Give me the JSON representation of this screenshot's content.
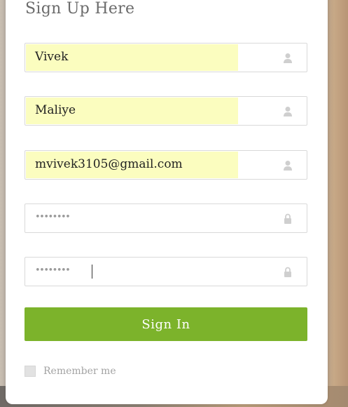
{
  "form": {
    "title": "Sign Up Here",
    "fields": {
      "first_name": {
        "value": "Vivek",
        "icon": "user-icon"
      },
      "last_name": {
        "value": "Maliye",
        "icon": "user-icon"
      },
      "email": {
        "value": "mvivek3105@gmail.com",
        "icon": "user-icon"
      },
      "password": {
        "value": "••••••••",
        "icon": "lock-icon"
      },
      "confirm_password": {
        "value": "••••••••",
        "icon": "lock-icon"
      }
    },
    "submit_label": "Sign In",
    "remember_label": "Remember me"
  },
  "colors": {
    "accent": "#7cb32b",
    "autofill": "#fbfdbf",
    "icon": "#cfcfcf"
  }
}
